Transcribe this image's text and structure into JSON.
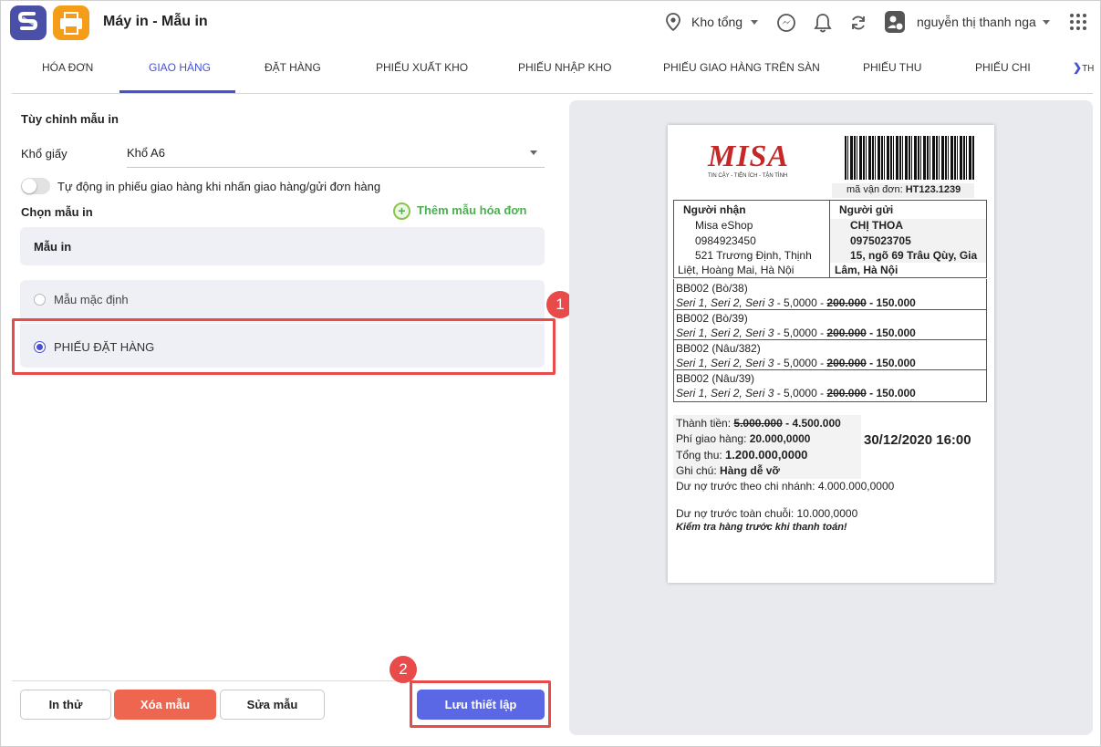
{
  "header": {
    "title": "Máy in - Mẫu in",
    "warehouse": "Kho tổng",
    "user": "nguyễn thị thanh nga"
  },
  "tabs": [
    "HÓA ĐƠN",
    "GIAO HÀNG",
    "ĐẶT HÀNG",
    "PHIẾU XUẤT KHO",
    "PHIẾU NHẬP KHO",
    "PHIẾU GIAO HÀNG TRÊN SÀN",
    "PHIẾU THU",
    "PHIẾU CHI",
    "TH"
  ],
  "active_tab": "GIAO HÀNG",
  "settings": {
    "section_title": "Tùy chỉnh mẫu in",
    "paper_label": "Khổ giấy",
    "paper_value": "Khổ A6",
    "auto_print_label": "Tự động in phiếu giao hàng khi nhấn giao hàng/gửi đơn hàng",
    "choose_label": "Chọn mẫu in",
    "add_template": "Thêm mẫu hóa đơn",
    "template_header": "Mẫu in",
    "templates": [
      "Mẫu mặc định",
      "PHIẾU ĐẶT HÀNG"
    ],
    "selected_template": "PHIẾU ĐẶT HÀNG"
  },
  "markers": {
    "one": "1",
    "two": "2"
  },
  "buttons": {
    "test": "In thử",
    "delete": "Xóa mẫu",
    "edit": "Sửa mẫu",
    "save": "Lưu thiết lập"
  },
  "receipt": {
    "logo": "MISA",
    "slogan": "TIN CẬY - TIỆN ÍCH - TẬN TÌNH",
    "tracking_label": "mã vận đơn:",
    "tracking_value": "HT123.1239",
    "receiver_label": "Người nhận",
    "receiver_name": "Misa eShop",
    "receiver_phone": "0984923450",
    "receiver_addr1": "521 Trương Định, Thịnh",
    "receiver_addr2": "Liệt, Hoàng Mai, Hà Nội",
    "sender_label": "Người gửi",
    "sender_name": "CHỊ THOA",
    "sender_phone": "0975023705",
    "sender_addr1": "15, ngõ 69 Trâu Qùy, Gia",
    "sender_addr2": "Lâm, Hà Nội",
    "items": [
      {
        "code": "BB002 (Bò/38)",
        "desc": "Seri 1, Seri 2, Seri 3",
        "qty": " - 5,0000 - ",
        "old_price": "200.000",
        "new_price": " - 150.000"
      },
      {
        "code": "BB002 (Bò/39)",
        "desc": "Seri 1, Seri 2, Seri 3",
        "qty": " - 5,0000 - ",
        "old_price": "200.000",
        "new_price": " - 150.000"
      },
      {
        "code": "BB002 (Nâu/382)",
        "desc": "Seri 1, Seri 2, Seri 3",
        "qty": " - 5,0000 - ",
        "old_price": "200.000",
        "new_price": " - 150.000"
      },
      {
        "code": "BB002 (Nâu/39)",
        "desc": "Seri 1, Seri 2, Seri 3",
        "qty": " - 5,0000 - ",
        "old_price": "200.000",
        "new_price": " - 150.000"
      }
    ],
    "subtotal_label": "Thành tiền:",
    "subtotal_old": "5.000.000",
    "subtotal_new": " - 4.500.000",
    "shipping_label": "Phí giao hàng:",
    "shipping_value": "20.000,0000",
    "total_label": "Tổng thu:",
    "total_value": "1.200.000,0000",
    "note_label": "Ghi chú:",
    "note_value": "Hàng dễ vỡ",
    "datetime": "30/12/2020 16:00",
    "debt_branch": "Dư nợ trước theo chi nhánh: 4.000.000,0000",
    "debt_chain": "Dư nợ trước toàn chuỗi: 10.000,0000",
    "check_note": "Kiểm tra hàng trước khi thanh toán!"
  }
}
